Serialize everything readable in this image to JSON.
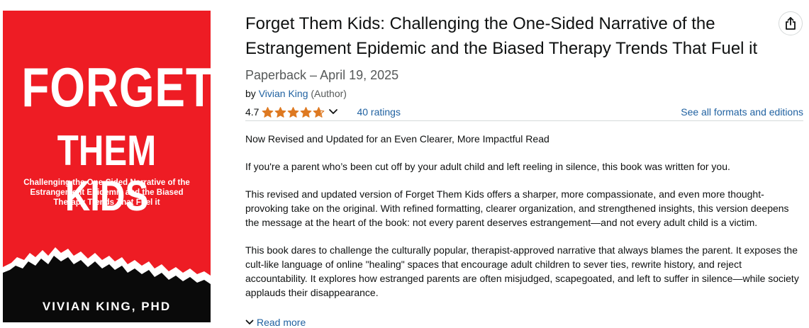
{
  "cover": {
    "title_line1": "FORGET",
    "title_line2": "THEM KIDS",
    "subtitle": "Challenging the One-Sided Narrative of the Estrangement Epidemic and the Biased Therapy Trends That Fuel it",
    "author": "VIVIAN KING, PHD",
    "background_color": "#ee1c24"
  },
  "product": {
    "title": "Forget Them Kids: Challenging the One-Sided Narrative of the Estrangement Epidemic and the Biased Therapy Trends That Fuel it",
    "format": "Paperback – April 19, 2025",
    "by_prefix": "by",
    "author_name": "Vivian King",
    "author_role": "(Author)",
    "rating_value": "4.7",
    "rating_stars": 4.7,
    "ratings_count": "40 ratings",
    "formats_link": "See all formats and editions",
    "star_color": "#de7921",
    "link_color": "#2162a1"
  },
  "description": {
    "paragraphs": [
      "Now Revised and Updated for an Even Clearer, More Impactful Read",
      "If you're a parent who’s been cut off by your adult child and left reeling in silence, this book was written for you.",
      "This revised and updated version of Forget Them Kids offers a sharper, more compassionate, and even more thought-provoking take on the original. With refined formatting, clearer organization, and strengthened insights, this version deepens the message at the heart of the book: not every parent deserves estrangement—and not every adult child is a victim.",
      "This book dares to challenge the culturally popular, therapist-approved narrative that always blames the parent. It exposes the cult-like language of online \"healing\" spaces that encourage adult children to sever ties, rewrite history, and reject accountability. It explores how estranged parents are often misjudged, scapegoated, and left to suffer in silence—while society applauds their disappearance."
    ],
    "read_more": "Read more"
  },
  "icons": {
    "share": "share-icon",
    "star": "star-icon",
    "chevron_down": "chevron-down-icon"
  }
}
